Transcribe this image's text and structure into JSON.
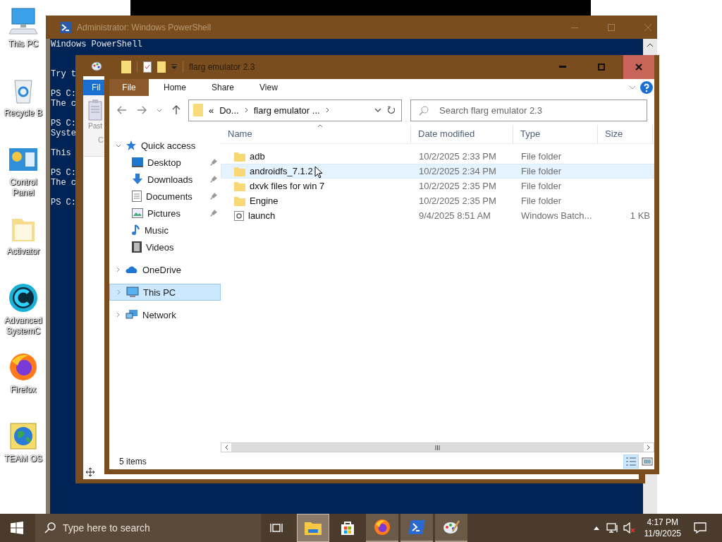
{
  "desktop_icons": [
    {
      "kind": "pc",
      "label": "This PC"
    },
    {
      "kind": "bin",
      "label": "Recycle B"
    },
    {
      "kind": "panel",
      "label": "Control Panel"
    },
    {
      "kind": "folder",
      "label": "Activator"
    },
    {
      "kind": "cleaner",
      "label": "Advanced SystemC"
    },
    {
      "kind": "firefox",
      "label": "Firefox"
    },
    {
      "kind": "globe",
      "label": "TEAM OS"
    }
  ],
  "powershell": {
    "title": "Administrator: Windows PowerShell",
    "paragraphs": [
      [
        "Windows PowerShell"
      ],
      [
        "Try t"
      ],
      [
        "PS C:",
        "The c"
      ],
      [
        "PS C:",
        "Syste"
      ],
      [
        "This"
      ],
      [
        "PS C:",
        "The c"
      ],
      [
        "PS C:"
      ]
    ]
  },
  "back_window": {
    "tab": "Fil",
    "paste": "Past",
    "group": "C"
  },
  "explorer": {
    "title": "flarg emulator 2.3",
    "ribbon_tabs": [
      {
        "label": "File",
        "kind": "menu"
      },
      {
        "label": "Home",
        "kind": "tab"
      },
      {
        "label": "Share",
        "kind": "tab"
      },
      {
        "label": "View",
        "kind": "tab"
      }
    ],
    "address": {
      "overflow": "«",
      "parts": [
        "Do...",
        "flarg emulator ..."
      ]
    },
    "search": {
      "placeholder": "Search flarg emulator 2.3"
    },
    "nav": [
      {
        "label": "Quick access",
        "kind": "star",
        "expanded": true,
        "selected": false,
        "children": [
          {
            "label": "Desktop",
            "kind": "desktop",
            "pinned": true,
            "selected": false
          },
          {
            "label": "Downloads",
            "kind": "downloads",
            "pinned": true,
            "selected": false
          },
          {
            "label": "Documents",
            "kind": "documents",
            "pinned": true,
            "selected": false
          },
          {
            "label": "Pictures",
            "kind": "pictures",
            "pinned": true,
            "selected": false
          },
          {
            "label": "Music",
            "kind": "music",
            "pinned": false,
            "selected": false
          },
          {
            "label": "Videos",
            "kind": "videos",
            "pinned": false,
            "selected": false
          }
        ]
      },
      {
        "label": "OneDrive",
        "kind": "cloud",
        "expanded": false,
        "selected": false
      },
      {
        "label": "This PC",
        "kind": "pc",
        "expanded": false,
        "selected": true
      },
      {
        "label": "Network",
        "kind": "network",
        "expanded": false,
        "selected": false
      }
    ],
    "columns": [
      "Name",
      "Date modified",
      "Type",
      "Size"
    ],
    "rows": [
      {
        "kind": "folder",
        "name": "adb",
        "date": "10/2/2025 2:33 PM",
        "type": "File folder",
        "selected": false
      },
      {
        "kind": "folder",
        "name": "androidfs_7.1.2",
        "date": "10/2/2025 2:34 PM",
        "type": "File folder",
        "selected": true
      },
      {
        "kind": "folder",
        "name": "dxvk files for win 7",
        "date": "10/2/2025 2:35 PM",
        "type": "File folder",
        "selected": false
      },
      {
        "kind": "folder",
        "name": "Engine",
        "date": "10/2/2025 2:35 PM",
        "type": "File folder",
        "selected": false
      },
      {
        "kind": "batch",
        "name": "launch",
        "date": "9/4/2025 8:51 AM",
        "type": "Windows Batch...",
        "size": "1 KB",
        "selected": false
      }
    ],
    "status": "5 items"
  },
  "taskbar": {
    "search": {
      "placeholder": "Type here to search"
    },
    "apps": [
      {
        "kind": "explorer",
        "running": true,
        "selected": true
      },
      {
        "kind": "store",
        "running": false,
        "selected": false
      },
      {
        "kind": "firefox",
        "running": true,
        "selected": false
      },
      {
        "kind": "powershell",
        "running": true,
        "selected": false
      },
      {
        "kind": "paint",
        "running": true,
        "selected": false
      }
    ],
    "time": "4:17 PM",
    "date": "11/9/2025"
  }
}
